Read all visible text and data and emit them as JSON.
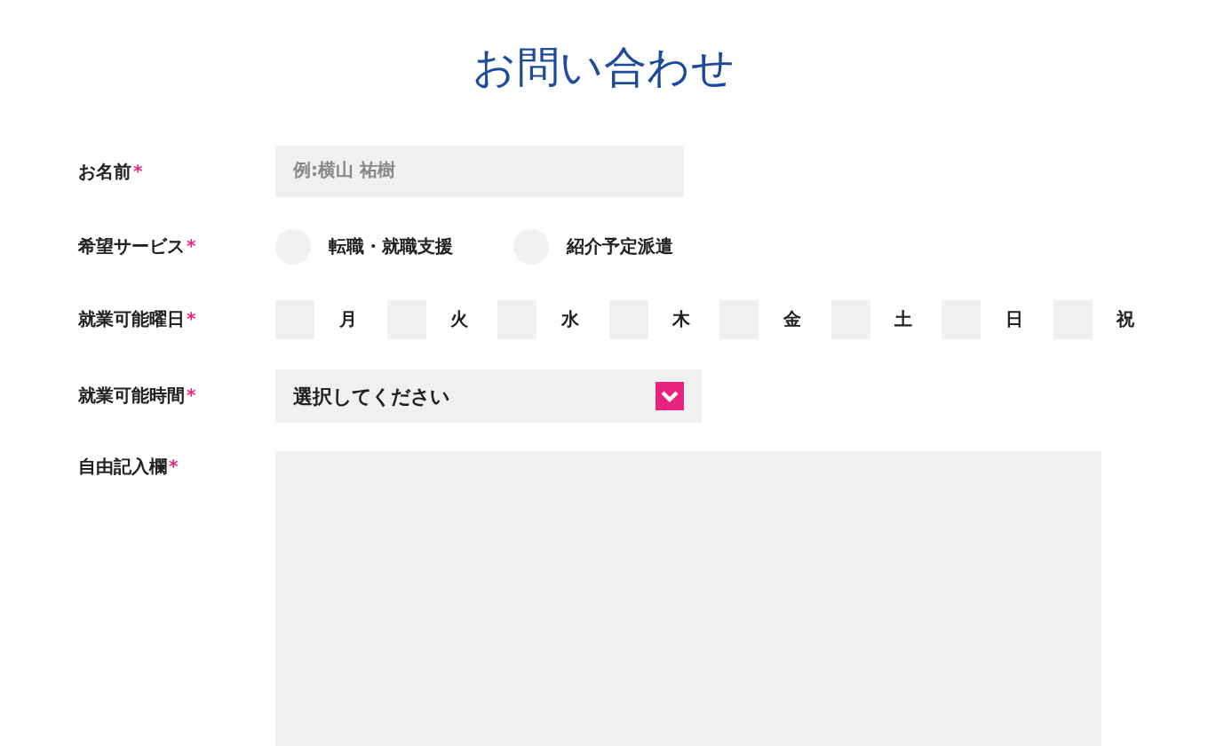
{
  "title": "お問い合わせ",
  "fields": [
    {
      "kind": "text",
      "label": "お名前",
      "mark": "*",
      "placeholder": "例:横山 祐樹"
    },
    {
      "kind": "radio",
      "label": "希望サービス",
      "mark": "*",
      "options": [
        {
          "label": "転職・就職支援",
          "selected": false
        },
        {
          "label": "紹介予定派遣",
          "selected": false
        }
      ]
    },
    {
      "kind": "checkbox",
      "label": "就業可能曜日",
      "mark": "*",
      "options": [
        {
          "label": "月",
          "checked": false
        },
        {
          "label": "火",
          "checked": false
        },
        {
          "label": "水",
          "checked": false
        },
        {
          "label": "木",
          "checked": false
        },
        {
          "label": "金",
          "checked": false
        },
        {
          "label": "土",
          "checked": false
        },
        {
          "label": "日",
          "checked": false
        },
        {
          "label": "祝",
          "checked": false
        }
      ]
    },
    {
      "kind": "select",
      "label": "就業可能時間",
      "mark": "*",
      "value": "選択してください"
    },
    {
      "kind": "textarea",
      "label": "自由記入欄",
      "mark": "*"
    }
  ]
}
